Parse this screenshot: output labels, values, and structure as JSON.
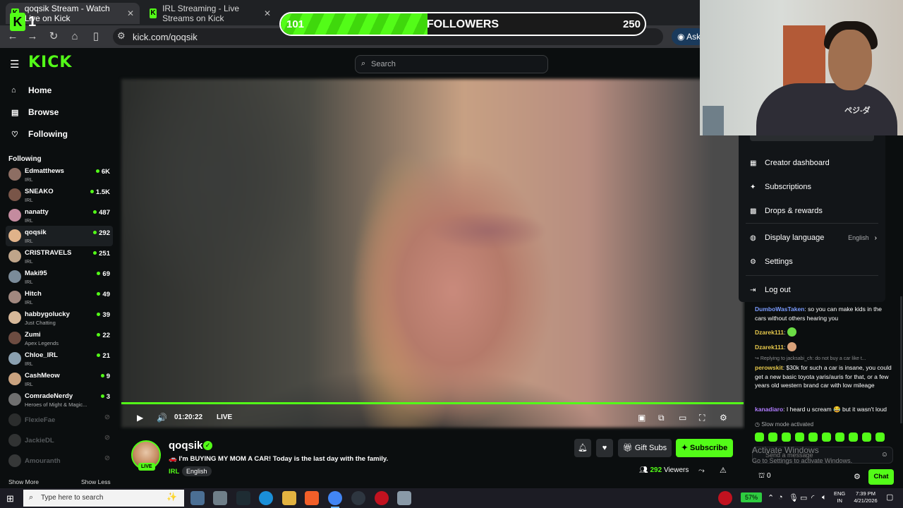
{
  "browser": {
    "tabs": [
      {
        "title": "qoqsik Stream - Watch Live on Kick",
        "active": true
      },
      {
        "title": "IRL Streaming - Live Streams on Kick",
        "active": false
      }
    ],
    "url": "kick.com/qoqsik",
    "ask_label": "Ask"
  },
  "followers_widget": {
    "logo_letter": "K",
    "rank": "1",
    "current": "101",
    "label": "FOLLOWERS",
    "goal": "250",
    "progress": 0.404
  },
  "header": {
    "logo": "KICK",
    "search_placeholder": "Search"
  },
  "sidebar": {
    "nav": [
      {
        "label": "Home",
        "icon": "home-icon"
      },
      {
        "label": "Browse",
        "icon": "browse-icon"
      },
      {
        "label": "Following",
        "icon": "heart-icon"
      }
    ],
    "following_title": "Following",
    "channels": [
      {
        "name": "Edmatthews",
        "category": "IRL",
        "viewers": "6K",
        "live": true
      },
      {
        "name": "SNEAKO",
        "category": "IRL",
        "viewers": "1.5K",
        "live": true
      },
      {
        "name": "nanatty",
        "category": "IRL",
        "viewers": "487",
        "live": true
      },
      {
        "name": "qoqsik",
        "category": "IRL",
        "viewers": "292",
        "live": true,
        "selected": true
      },
      {
        "name": "CRISTRAVELS",
        "category": "IRL",
        "viewers": "251",
        "live": true
      },
      {
        "name": "Maki95",
        "category": "IRL",
        "viewers": "69",
        "live": true
      },
      {
        "name": "Hitch",
        "category": "IRL",
        "viewers": "49",
        "live": true
      },
      {
        "name": "habbygolucky",
        "category": "Just Chatting",
        "viewers": "39",
        "live": true
      },
      {
        "name": "Zumi",
        "category": "Apex Legends",
        "viewers": "22",
        "live": true
      },
      {
        "name": "Chloe_IRL",
        "category": "IRL",
        "viewers": "21",
        "live": true
      },
      {
        "name": "CashMeow",
        "category": "IRL",
        "viewers": "9",
        "live": true
      },
      {
        "name": "ComradeNerdy",
        "category": "Heroes of Might & Magic...",
        "viewers": "3",
        "live": true
      },
      {
        "name": "FlexieFae",
        "category": "",
        "viewers": "",
        "live": false
      },
      {
        "name": "JackieDL",
        "category": "",
        "viewers": "",
        "live": false
      },
      {
        "name": "Amouranth",
        "category": "",
        "viewers": "",
        "live": false
      }
    ],
    "show_more": "Show More",
    "show_less": "Show Less"
  },
  "player": {
    "time": "01:20:22",
    "live_label": "LIVE"
  },
  "stream": {
    "streamer": "qoqsik",
    "live_badge": "LIVE",
    "title": "🚗 I'm BUYING MY MOM A CAR! Today is the last day with the family.",
    "category": "IRL",
    "language": "English",
    "gift_label": "Gift Subs",
    "subscribe_label": "Subscribe",
    "viewers": "292",
    "viewers_label": "Viewers"
  },
  "user_menu": {
    "items": [
      {
        "label": "Creator dashboard",
        "icon": "dashboard-icon"
      },
      {
        "label": "Subscriptions",
        "icon": "star-icon"
      },
      {
        "label": "Drops & rewards",
        "icon": "gift-icon"
      },
      {
        "label": "Display language",
        "icon": "globe-icon",
        "value": "English"
      },
      {
        "label": "Settings",
        "icon": "gear-icon"
      },
      {
        "label": "Log out",
        "icon": "logout-icon"
      }
    ]
  },
  "chat": {
    "messages": [
      {
        "user": "DumboWasTaken",
        "text": "so you can make kids in the cars without others hearing you",
        "color": "#7b9cff"
      },
      {
        "user": "Dzarek111",
        "text": "",
        "color": "#e6c84b"
      },
      {
        "user": "Dzarek111",
        "text": "",
        "color": "#e6c84b"
      },
      {
        "reply": "Replying to jacksabi_ch: do not buy a car like t..."
      },
      {
        "user": "perowskit",
        "text": "$30k for such a car is insane, you could get a new basic toyota yaris/auris for that, or a few years old western brand car with low mileage",
        "color": "#e6c84b"
      },
      {
        "user": "kanadiaro",
        "text": "I heard u scream 😂 but it wasn't loud",
        "color": "#b07cff"
      }
    ],
    "slow_mode": "Slow mode activated",
    "input_placeholder": "Send a message",
    "points": "0",
    "chat_button": "Chat"
  },
  "windows": {
    "activate_title": "Activate Windows",
    "activate_sub": "Go to Settings to activate Windows.",
    "search_placeholder": "Type here to search",
    "battery": "57%",
    "lang_top": "ENG",
    "lang_bottom": "IN",
    "time": "7:39 PM",
    "date": "4/21/2026",
    "notifications": "4"
  },
  "colors": {
    "kick_green": "#53fc18",
    "bg": "#0b0e0f"
  }
}
